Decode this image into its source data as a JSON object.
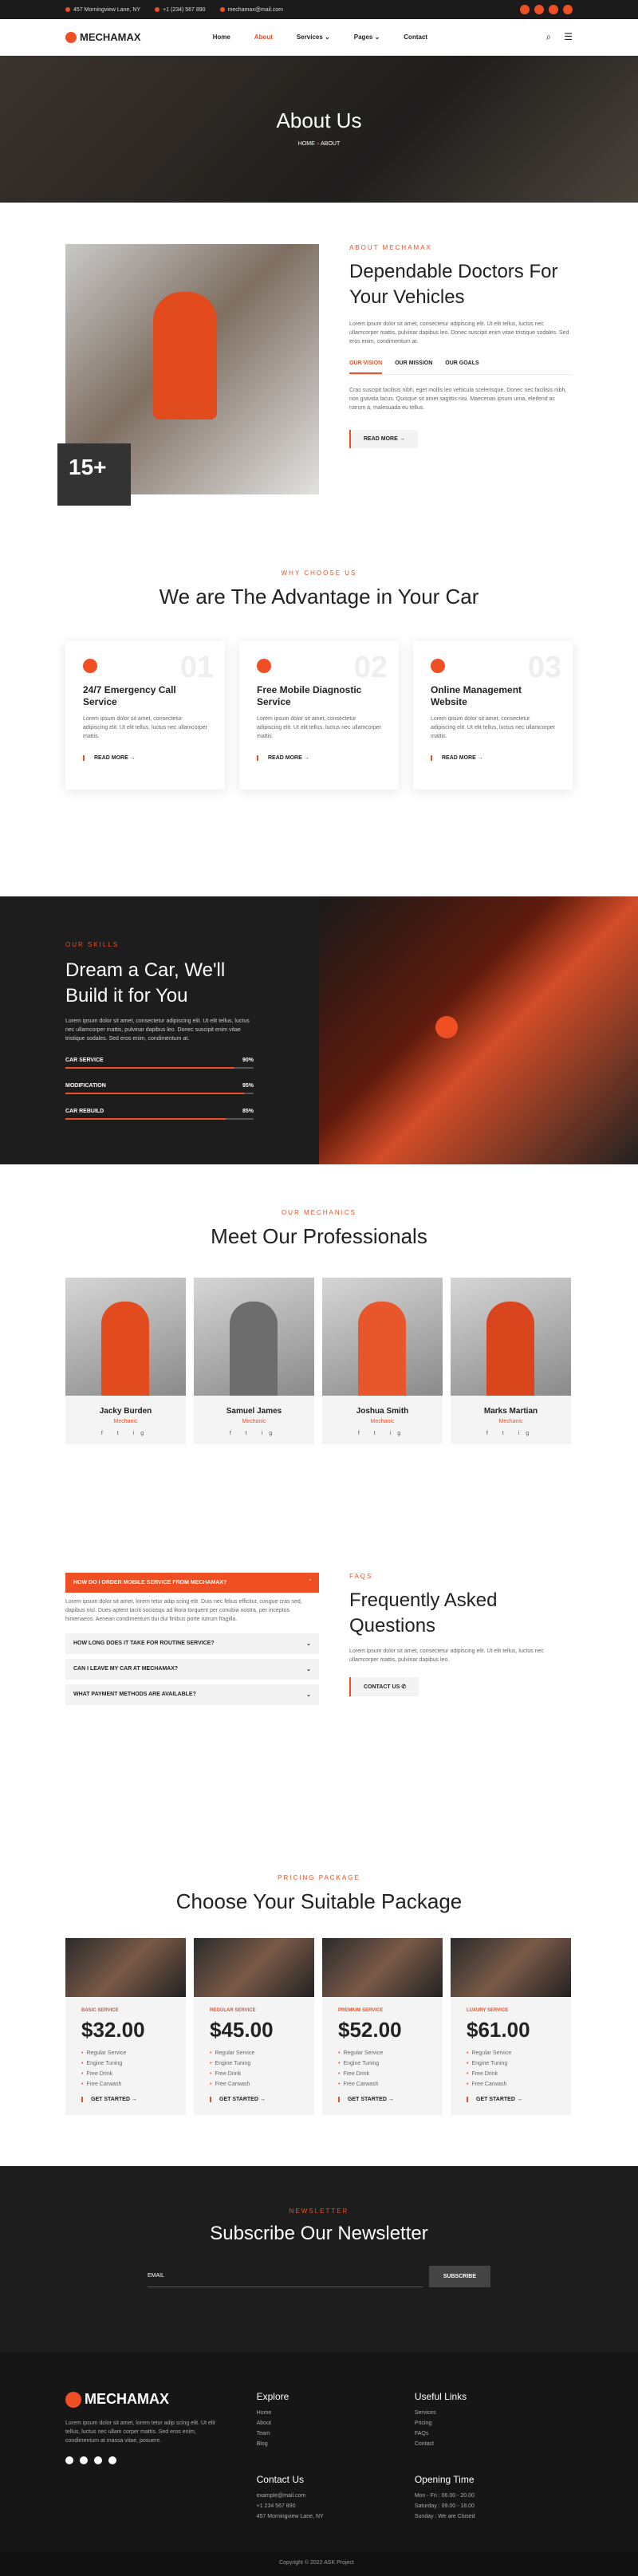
{
  "topbar": {
    "address": "457 Morningview Lane, NY",
    "phone": "+1 (234) 567 890",
    "email": "mechamax@mail.com"
  },
  "nav": {
    "logo": "MECHAMAX",
    "items": [
      "Home",
      "About",
      "Services",
      "Pages",
      "Contact"
    ]
  },
  "hero": {
    "title": "About Us",
    "breadcrumb_home": "HOME",
    "breadcrumb_current": "ABOUT"
  },
  "about": {
    "badge_number": "15+",
    "eyebrow": "ABOUT MECHAMAX",
    "title": "Dependable Doctors For Your Vehicles",
    "text": "Lorem ipsum dolor sit amet, consectetur adipiscing elit. Ut elit tellus, luctus nec ullamcorper mattis, pulvinar dapibus leo. Donec suscipit enim vitae tristique sodales. Sed eros enim, condimentum at.",
    "tabs": [
      "OUR VISION",
      "OUR MISSION",
      "OUR GOALS"
    ],
    "tab_text": "Cras suscipit facilisis nibh, eget mollis leo vehicula scelerisque. Donec nec facilisis nibh, non gravida lacus. Quisque sit amet sagittis nisi. Maecenas ipsum urna, eleifend ac rutrum a, malesuada eu tellus.",
    "button": "READ MORE"
  },
  "why": {
    "eyebrow": "WHY CHOOSE US",
    "title": "We are The Advantage in Your Car",
    "cards": [
      {
        "num": "01",
        "title": "24/7 Emergency Call Service",
        "text": "Lorem ipsum dolor sit amet, consectetur adipiscing elit. Ut elit tellus, luctus nec ullamcorper mattis.",
        "link": "READ MORE"
      },
      {
        "num": "02",
        "title": "Free Mobile Diagnostic Service",
        "text": "Lorem ipsum dolor sit amet, consectetur adipiscing elit. Ut elit tellus, luctus nec ullamcorper mattis.",
        "link": "READ MORE"
      },
      {
        "num": "03",
        "title": "Online Management Website",
        "text": "Lorem ipsum dolor sit amet, consectetur adipiscing elit. Ut elit tellus, luctus nec ullamcorper mattis.",
        "link": "READ MORE"
      }
    ]
  },
  "skills": {
    "eyebrow": "OUR SKILLS",
    "title": "Dream a Car, We'll Build it for You",
    "text": "Lorem ipsum dolor sit amet, consectetur adipiscing elit. Ut elit tellus, luctus nec ullamcorper mattis, pulvinar dapibus leo. Donec suscipit enim vitae tristique sodales. Sed eros enim, condimentum at.",
    "bars": [
      {
        "label": "CAR SERVICE",
        "value": "90%",
        "pct": 90
      },
      {
        "label": "MODIFICATION",
        "value": "95%",
        "pct": 95
      },
      {
        "label": "CAR REBUILD",
        "value": "85%",
        "pct": 85
      }
    ]
  },
  "team": {
    "eyebrow": "OUR MECHANICS",
    "title": "Meet Our Professionals",
    "members": [
      {
        "name": "Jacky Burden",
        "role": "Mechanic",
        "color": "#e14b1d"
      },
      {
        "name": "Samuel James",
        "role": "Mechanic",
        "color": "#6d6d6d"
      },
      {
        "name": "Joshua Smith",
        "role": "Mechanic",
        "color": "#e8562c"
      },
      {
        "name": "Marks Martian",
        "role": "Mechanic",
        "color": "#d9451c"
      }
    ]
  },
  "faq": {
    "questions": [
      {
        "q": "HOW DO I ORDER MOBILE SERVICE FROM MECHAMAX?",
        "a": "Lorem ipsum dolor sit amet, lorem tetur adip scing elit. Duis nec felius efficitur, congue cras sed, dapibus nisl. Dues aptent taciti sociosqu ad litora torquent per conubia nostra, per inceptos himenaeos. Aenean condimentum dui dui finibus porte rutrum fragilla."
      },
      {
        "q": "HOW LONG DOES IT TAKE FOR ROUTINE SERVICE?"
      },
      {
        "q": "CAN I LEAVE MY CAR AT MECHAMAX?"
      },
      {
        "q": "WHAT PAYMENT METHODS ARE AVAILABLE?"
      }
    ],
    "eyebrow": "FAQS",
    "title": "Frequently Asked Questions",
    "text": "Lorem ipsum dolor sit amet, consectetur adipiscing elit. Ut elit tellus, luctus nec ullamcorper mattis, pulvinar dapibus leo.",
    "button": "CONTACT US"
  },
  "pricing": {
    "eyebrow": "PRICING PACKAGE",
    "title": "Choose Your Suitable Package",
    "plans": [
      {
        "tag": "BASIC SERVICE",
        "price": "$32.00",
        "features": [
          "Regular Service",
          "Engine Tuning",
          "Free Drink",
          "Free Carwash"
        ],
        "button": "GET STARTED"
      },
      {
        "tag": "REGULAR SERVICE",
        "price": "$45.00",
        "features": [
          "Regular Service",
          "Engine Tuning",
          "Free Drink",
          "Free Carwash"
        ],
        "button": "GET STARTED"
      },
      {
        "tag": "PREMIUM SERVICE",
        "price": "$52.00",
        "features": [
          "Regular Service",
          "Engine Tuning",
          "Free Drink",
          "Free Carwash"
        ],
        "button": "GET STARTED"
      },
      {
        "tag": "LUXURY SERVICE",
        "price": "$61.00",
        "features": [
          "Regular Service",
          "Engine Tuning",
          "Free Drink",
          "Free Carwash"
        ],
        "button": "GET STARTED"
      }
    ]
  },
  "newsletter": {
    "eyebrow": "NEWSLETTER",
    "title": "Subscribe Our Newsletter",
    "placeholder": "EMAIL",
    "button": "SUBSCRIBE"
  },
  "footer": {
    "logo": "MECHAMAX",
    "text": "Lorem ipsum dolor sit amet, lorem tetur adip scing elit. Ut elit tellus, luctus nec ullam corper mattis. Sed eros enim, condimentum at massa vitae, posuere.",
    "explore_title": "Explore",
    "explore": [
      "Home",
      "About",
      "Team",
      "Blog"
    ],
    "links_title": "Useful Links",
    "links": [
      "Services",
      "Pricing",
      "FAQs",
      "Contact"
    ],
    "contact_title": "Contact Us",
    "contact": [
      "example@mail.com",
      "+1 234 567 890",
      "457 Morningview Lane, NY"
    ],
    "hours_title": "Opening Time",
    "hours": [
      "Mon - Fri : 06.00 - 20.00",
      "Saturday : 09.00 - 18.00",
      "Sunday : We are Closed"
    ],
    "copyright": "Copyright © 2022 ASK Project"
  },
  "colors": {
    "accent": "#f04e23",
    "dark": "#1d1d1d"
  }
}
